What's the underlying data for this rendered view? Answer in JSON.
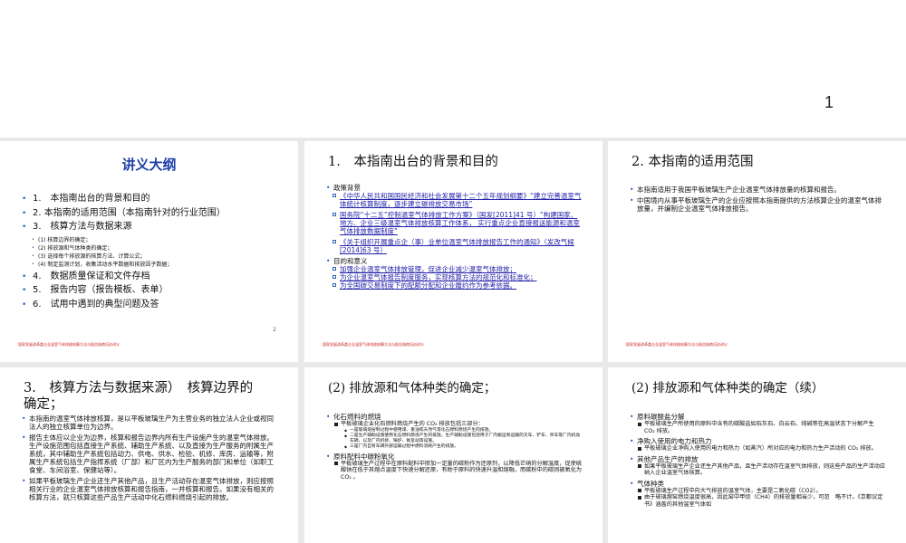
{
  "page_number": "1",
  "footer_text": "国家发展改革委企业温室气体排放核算方法与报告指南培训讲义",
  "slide1": {
    "title": "讲义大纲",
    "items": [
      {
        "text": "1.　本指南出台的背景和目的",
        "level": 1
      },
      {
        "text": "2. 本指南的适用范围（本指南针对的行业范围）",
        "level": 1
      },
      {
        "text": "3.　核算方法与数据来源",
        "level": 1
      },
      {
        "text": "(1) 核算边界的确定；",
        "level": 2
      },
      {
        "text": "(2) 排放源和气体种类的确定；",
        "level": 2
      },
      {
        "text": "(3) 选择每个排放源的核算方法、计算公式；",
        "level": 2
      },
      {
        "text": "(4) 制定监测计划，收集活动水平数据和排放因子数据；",
        "level": 2
      },
      {
        "text": "4.　数据质量保证和文件存档",
        "level": 1
      },
      {
        "text": "5.　报告内容（报告模板、表单）",
        "level": 1
      },
      {
        "text": "6.　试用中遇到的典型问题及答",
        "level": 1
      }
    ],
    "slide_number": "2"
  },
  "slide2": {
    "heading": "1.　本指南出台的背景和目的",
    "items": [
      {
        "text": "政策背景",
        "style": "b1"
      },
      {
        "text": "《中华人民共和国国民经济和社会发展第十二个五年规划纲要》“建立完善温室气体统计核算制度，逐步建立碳排放交易市场”",
        "style": "b2"
      },
      {
        "text": "国务院“十二五”控制温室气体排放工作方案》（国发[2011]41 号）“构建国家、地方、企业三级温室气体排放核算工作体系， 实行重点企业直接报送能源和温室气体排放数据制度”",
        "style": "b2"
      },
      {
        "text": "《关于组织开展重点企（事）业单位温室气体排放报告工作的通知》（发改气候 [2014]63 号）",
        "style": "b2"
      },
      {
        "text": "目的和意义",
        "style": "b1"
      },
      {
        "text": "加强企业温室气体排放管理，促进企业减少温室气体排放；",
        "style": "b2"
      },
      {
        "text": "为企业温室气体报告制度服务，实现核算方法的规范化和标准化；",
        "style": "b2"
      },
      {
        "text": "为全国碳交易制度下的配额分配和企业履约作为参考依据。",
        "style": "b2"
      }
    ]
  },
  "slide3": {
    "heading": "2. 本指南的适用范围",
    "items": [
      {
        "text": "本指南适用于我国平板玻璃生产企业温室气体排放量的核算和报告。"
      },
      {
        "text": "中国境内从事平板玻璃生产的企业应按照本指南提供的方法核算企业的温室气体排放量，并编制企业温室气体排放报告。"
      }
    ]
  },
  "slide4": {
    "heading": "3.　核算方法与数据来源）　核算边界的确定；",
    "items": [
      {
        "text": "本指南的温室气体排放核算，是以平板玻璃生产为主营业务的独立法人企业或视同法人的独立核算单位为边界。"
      },
      {
        "text": "报告主体应以企业为边界，核算和报告边界内所有生产设施产生的温室气体排放。生产设施范围包括直接生产系统、辅助生产系统、以及直接为生产服务的附属生产系统，其中辅助生产系统包括动力、供电、供水、检验、机修、库房、运输等，附属生产系统包括生产指挥系统（厂部）和厂区内为生产服务的部门和单位（如职工食堂、车间浴室、保健站等）。"
      },
      {
        "text": "如果平板玻璃生产企业还生产其他产品，且生产活动存在温室气体排放，则应按照相关行业的企业温室气体排放核算和报告指南，一并核算和报告。如果没有相关的核算方法，就只核算这些产品生产活动中化石燃料燃烧引起的排放。"
      }
    ]
  },
  "slide5": {
    "heading": "(2) 排放源和气体种类的确定；",
    "items": [
      {
        "text": "化石燃料的燃烧",
        "style": "b1"
      },
      {
        "text": "平板玻璃企业化石燃料燃烧产生的 CO₂ 排放包括三部分：",
        "style": "b2sq"
      },
      {
        "text": "一是玻璃熔窑制过程中使用煤、重油或天然气等化石燃料燃烧产生的排放。",
        "style": "b3"
      },
      {
        "text": "二是生产辅助设施使用化石燃料燃烧产生的排放。生产辅助设施包括用于厂内搬运和运输的叉车、铲车、吊车等厂内机动车辆，以及厂内机修、锅炉、氮氢站等设施。",
        "style": "b3"
      },
      {
        "text": "三是厂内自有车辆外部运输过程中燃料消耗产生的排放。",
        "style": "b3"
      },
      {
        "text": "原料配料中碳粉氧化",
        "style": "b1"
      },
      {
        "text": "平板玻璃生产过程中在原料配料中掺加一定量的碳粉作为还原剂，以降低芒硝的分解温度，促使硫酸钠在低于其熔点温度下快速分解还原，有助于原料的快速升温和熔融，而碳粉中的碳则被氧化为 CO₂ 。",
        "style": "b2sq"
      }
    ]
  },
  "slide6": {
    "heading": "(2) 排放源和气体种类的确定（续）",
    "items": [
      {
        "text": "原料碳酸盐分解",
        "style": "b1"
      },
      {
        "text": "平板玻璃生产所使用的原料中含有的碳酸盐如石灰石、白云石、纯碱等在高温状态下分解产生 CO₂ 排放。",
        "style": "b2sq"
      },
      {
        "text": "净购入使用的电力和热力",
        "style": "b1"
      },
      {
        "text": "平板玻璃企业净购入使用的电力和热力（如蒸汽）所对应的电力和热力生产活动的 CO₂ 排放。",
        "style": "b2sq"
      },
      {
        "text": "其他产品生产的排放",
        "style": "b1"
      },
      {
        "text": "如果平板玻璃生产企业还生产其他产品，且生产活动存在温室气体排放，则这些产品的生产活动应纳入企业温室气体核算。",
        "style": "b2sq"
      },
      {
        "text": "气体种类",
        "style": "b1"
      },
      {
        "text": "平板玻璃生产过程中向大气排放的温室气体，主要是二氧化碳（CO2）。",
        "style": "b2sq"
      },
      {
        "text": "由于玻璃熔窑燃烧温度很高，因此窑中甲烷（CH4）的排放量相当少，可忽　略不计。《京都议定书》涵盖的其他温室气体如",
        "style": "b2sq"
      }
    ]
  }
}
